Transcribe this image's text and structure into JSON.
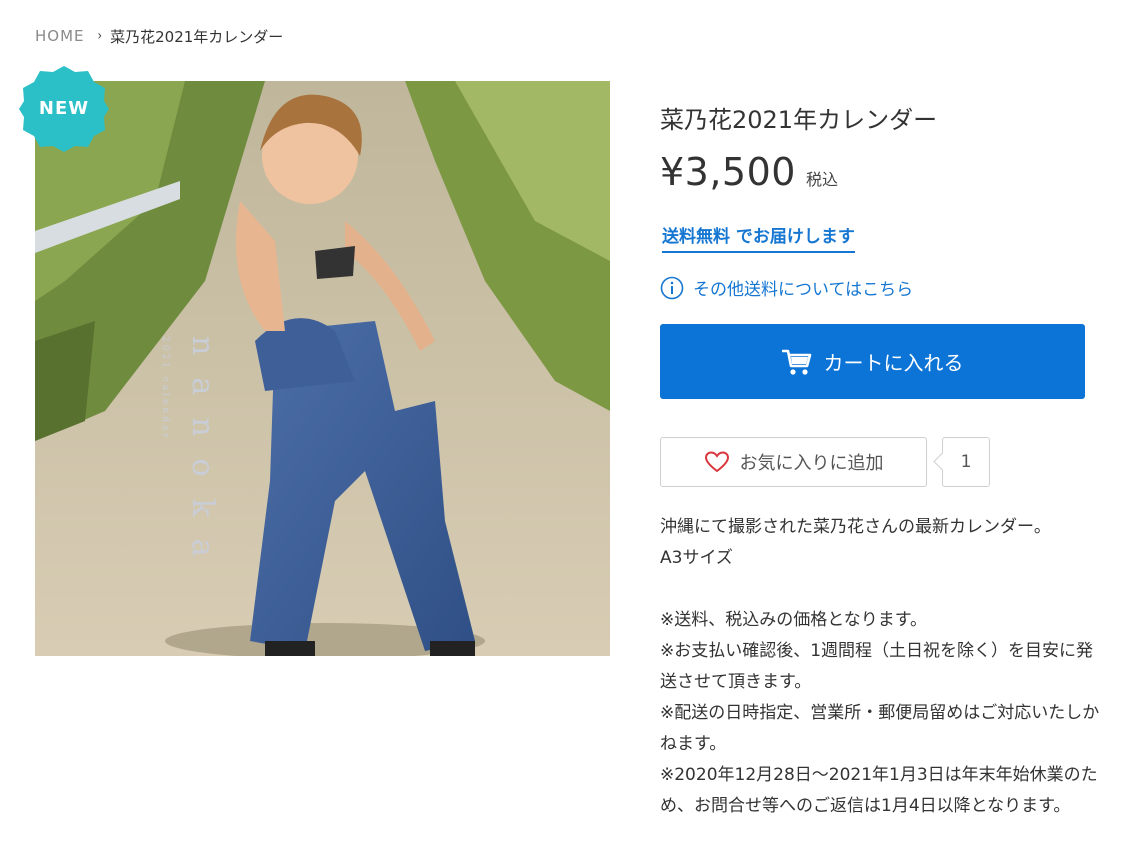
{
  "breadcrumb": {
    "home": "HOME",
    "separator": "›",
    "current": "菜乃花2021年カレンダー"
  },
  "product": {
    "badge": "NEW",
    "badge_color": "#2bbfc7",
    "image_text_main": "nanoka",
    "image_text_sub": "2021 calendar",
    "title": "菜乃花2021年カレンダー",
    "price": "¥3,500",
    "tax_label": "税込",
    "shipping_free": "送料無料 でお届けします",
    "shipping_info_link": "その他送料についてはこちら",
    "cart_button": "カートに入れる",
    "favorite_button": "お気に入りに追加",
    "favorite_count": "1",
    "description": [
      "沖縄にて撮影された菜乃花さんの最新カレンダー。",
      "A3サイズ",
      "",
      "※送料、税込みの価格となります。",
      "※お支払い確認後、1週間程（土日祝を除く）を目安に発",
      "送させて頂きます。",
      "※配送の日時指定、営業所・郵便局留めはご対応いたしか",
      "ねます。",
      "※2020年12月28日～2021年1月3日は年末年始休業のた",
      "め、お問合せ等へのご返信は1月4日以降となります。"
    ]
  },
  "colors": {
    "accent_blue": "#0b74d6",
    "link_blue": "#1677d2",
    "heart_red": "#d9363e"
  },
  "icons": {
    "breadcrumb_separator": "chevron-right-icon",
    "info": "info-icon",
    "cart": "cart-icon",
    "favorite": "heart-icon"
  }
}
